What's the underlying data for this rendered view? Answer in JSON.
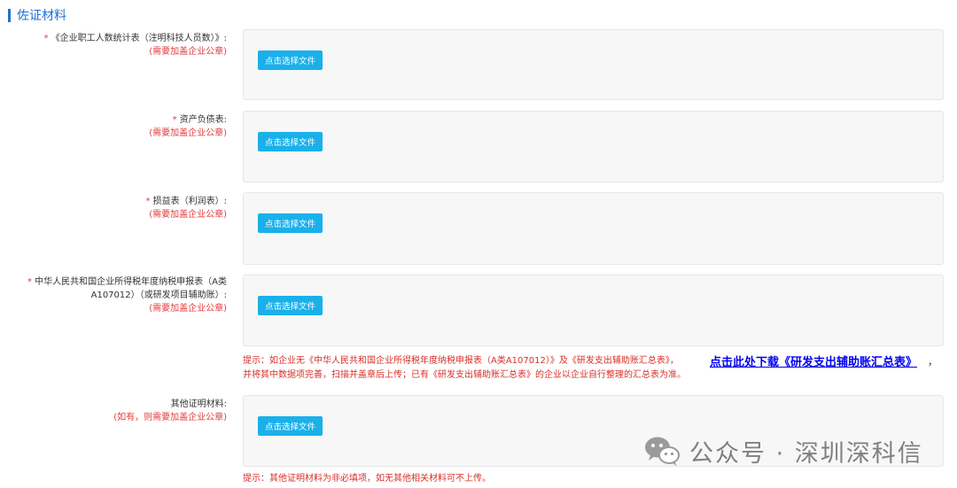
{
  "section": {
    "title": "佐证材料"
  },
  "fields": [
    {
      "required": "*",
      "label": "《企业职工人数统计表（注明科技人员数）》:",
      "note": "(需要加盖企业公章)",
      "button": "点击选择文件"
    },
    {
      "required": "*",
      "label": "资产负债表:",
      "note": "(需要加盖企业公章)",
      "button": "点击选择文件"
    },
    {
      "required": "*",
      "label": "损益表（利润表）:",
      "note": "(需要加盖企业公章)",
      "button": "点击选择文件"
    },
    {
      "required": "*",
      "label_line1": "中华人民共和国企业所得税年度纳税申报表（A类",
      "label_line2": "A107012）（或研发项目辅助账）:",
      "note": "(需要加盖企业公章)",
      "button": "点击选择文件"
    },
    {
      "label": "其他证明材料:",
      "note": "(如有，则需要加盖企业公章)",
      "button": "点击选择文件"
    }
  ],
  "hint_tax": {
    "line1": "提示：如企业无《中华人民共和国企业所得税年度纳税申报表（A类A107012）》及《研发支出辅助账汇总表》，",
    "line2": "并将其中数据项完善，扫描并盖章后上传；已有《研发支出辅助账汇总表》的企业以企业自行整理的汇总表为准。",
    "link": "点击此处下载《研发支出辅助账汇总表》",
    "link_suffix": "，"
  },
  "hint_other": "提示：其他证明材料为非必填项，如无其他相关材料可不上传。",
  "watermark": {
    "text": "公众号 · 深圳深科信",
    "icon": "wechat-icon"
  }
}
